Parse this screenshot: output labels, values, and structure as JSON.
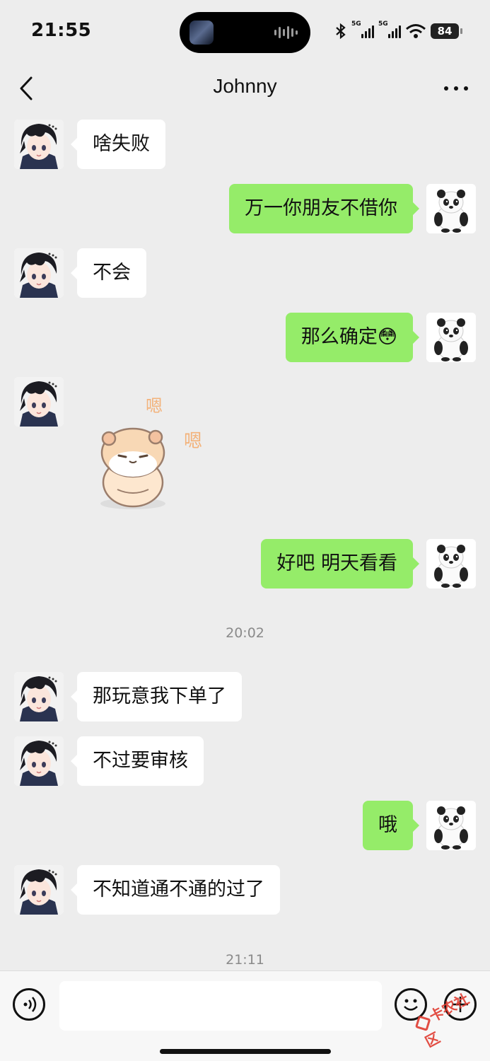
{
  "status_bar": {
    "time": "21:55",
    "network_1": "5G",
    "network_2": "5G",
    "battery": "84"
  },
  "header": {
    "title": "Johnny"
  },
  "messages": [
    {
      "side": "in",
      "text": "啥失败"
    },
    {
      "side": "out",
      "text": "万一你朋友不借你"
    },
    {
      "side": "in",
      "text": "不会"
    },
    {
      "side": "out",
      "text": "那么确定😳"
    },
    {
      "side": "in",
      "sticker": "hamster-sticker",
      "sticker_text": "嗯 嗯"
    },
    {
      "side": "out",
      "text": "好吧  明天看看"
    },
    {
      "timestamp": "20:02"
    },
    {
      "side": "in",
      "text": "那玩意我下单了"
    },
    {
      "side": "in",
      "text": "不过要审核"
    },
    {
      "side": "out",
      "text": "哦"
    },
    {
      "side": "in",
      "text": "不知道通不通的过了"
    },
    {
      "timestamp": "21:11"
    }
  ],
  "input": {
    "placeholder": ""
  },
  "watermark": "卡农社区",
  "colors": {
    "background": "#ededed",
    "outgoing_bubble": "#95ec69",
    "incoming_bubble": "#ffffff"
  },
  "icons": [
    "back-arrow-icon",
    "more-icon",
    "voice-icon",
    "emoji-icon",
    "plus-icon"
  ]
}
